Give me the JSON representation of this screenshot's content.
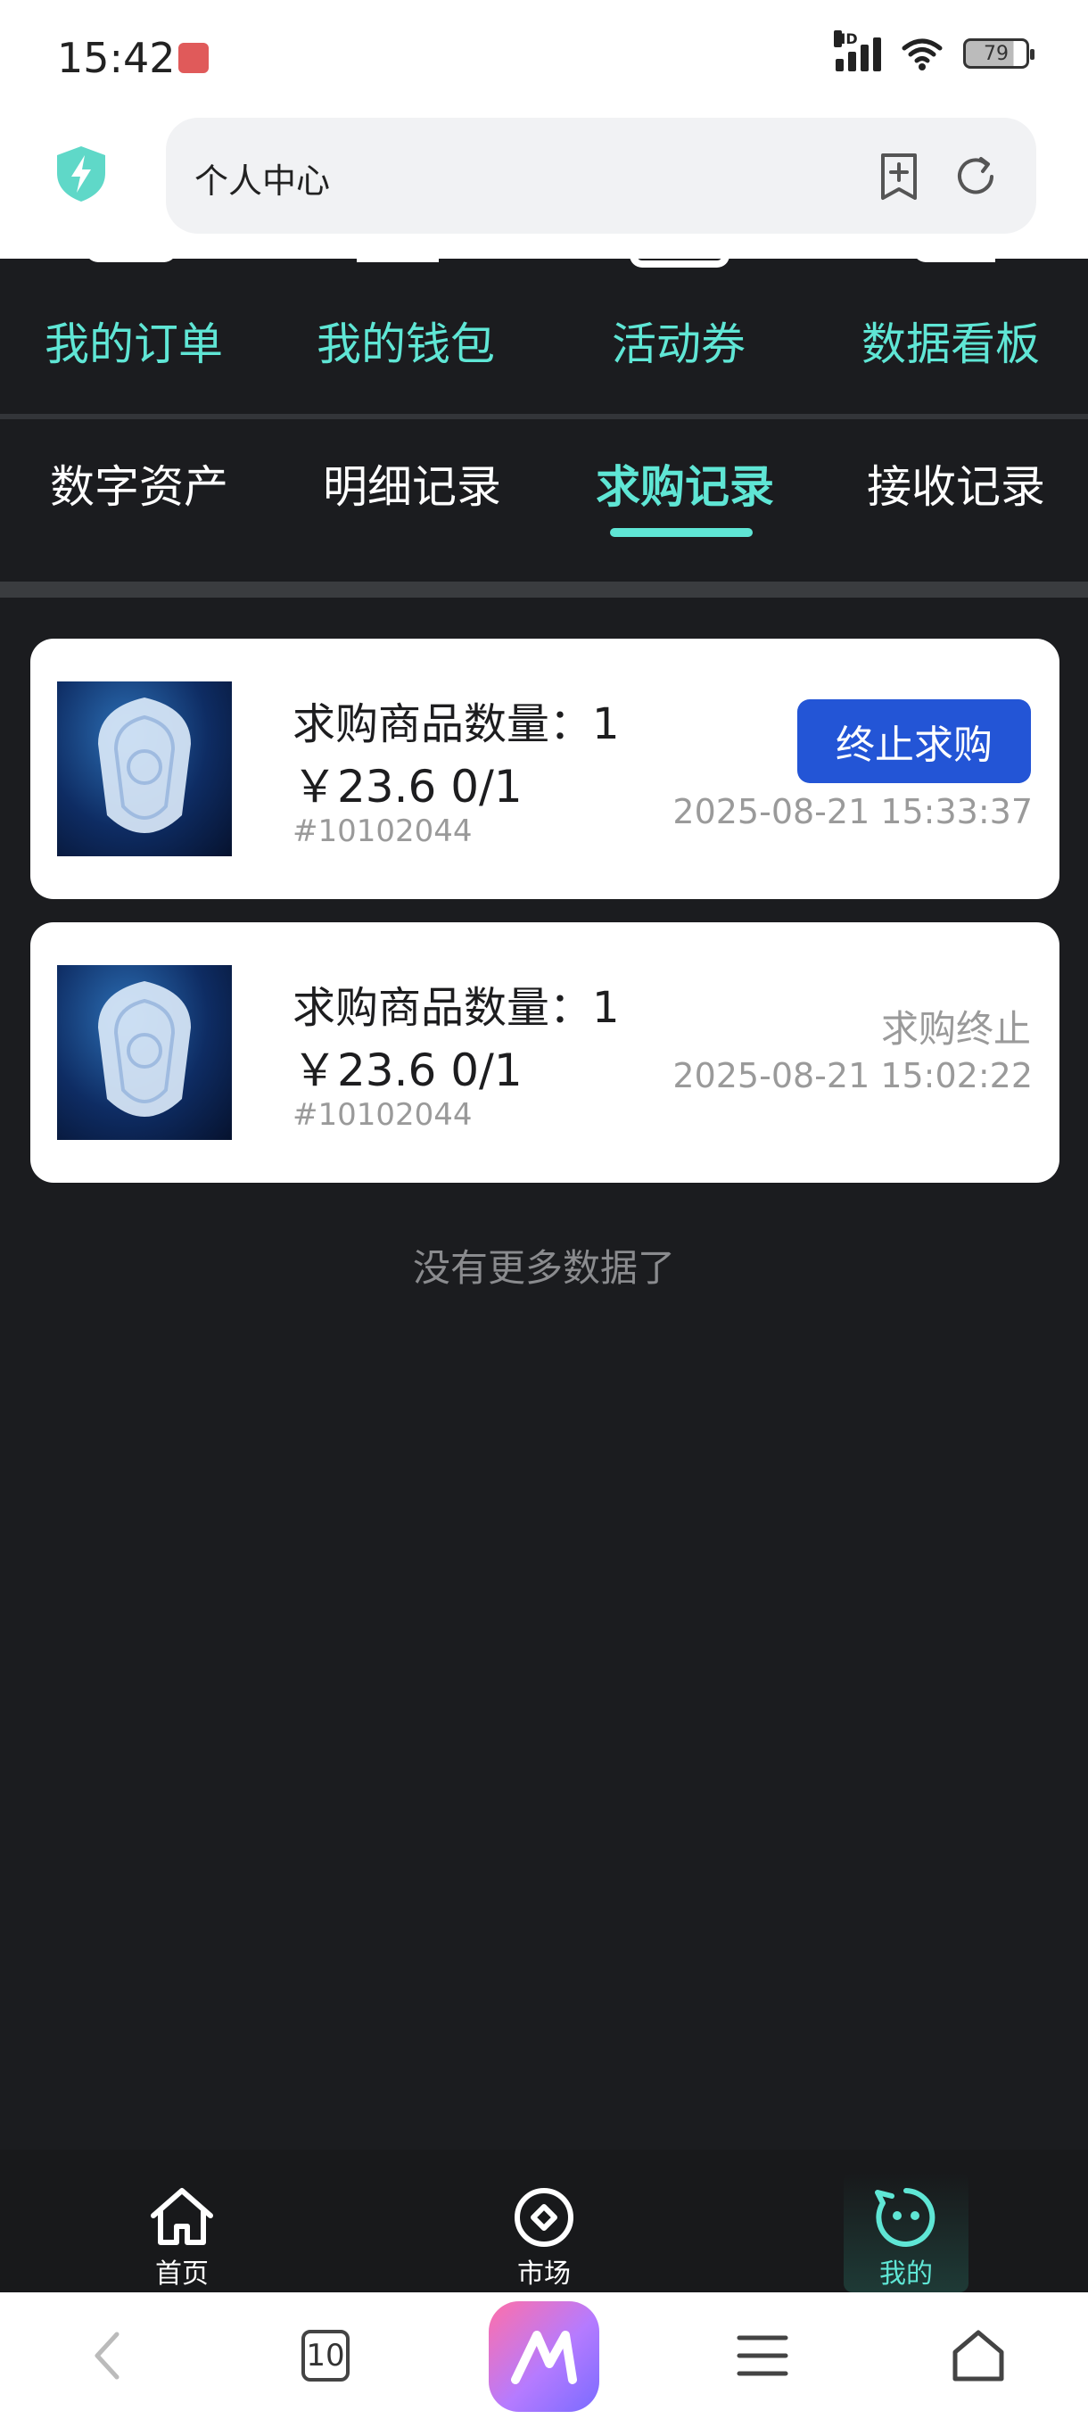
{
  "status_bar": {
    "time": "15:42",
    "battery": "79",
    "network": "HD"
  },
  "browser": {
    "title": "个人中心",
    "tab_count": "10"
  },
  "top_nav": {
    "items": [
      {
        "label": "我的订单"
      },
      {
        "label": "我的钱包"
      },
      {
        "label": "活动券"
      },
      {
        "label": "数据看板"
      }
    ]
  },
  "tabs": {
    "items": [
      {
        "label": "数字资产"
      },
      {
        "label": "明细记录"
      },
      {
        "label": "求购记录"
      },
      {
        "label": "接收记录"
      }
    ],
    "active_index": 2
  },
  "records": [
    {
      "quantity_text": "求购商品数量：1",
      "price_text": "￥23.6 0/1",
      "id_text": "#10102044",
      "time": "2025-08-21 15:33:37",
      "action_label": "终止求购"
    },
    {
      "quantity_text": "求购商品数量：1",
      "price_text": "￥23.6 0/1",
      "id_text": "#10102044",
      "time": "2025-08-21 15:02:22",
      "status_label": "求购终止"
    }
  ],
  "list_footer": "没有更多数据了",
  "app_nav": {
    "items": [
      {
        "label": "首页",
        "icon": "home-icon"
      },
      {
        "label": "市场",
        "icon": "market-icon"
      },
      {
        "label": "我的",
        "icon": "profile-icon"
      }
    ],
    "active_index": 2
  },
  "colors": {
    "accent": "#5fe6d5",
    "button": "#2355d6",
    "background": "#1b1c1f"
  }
}
